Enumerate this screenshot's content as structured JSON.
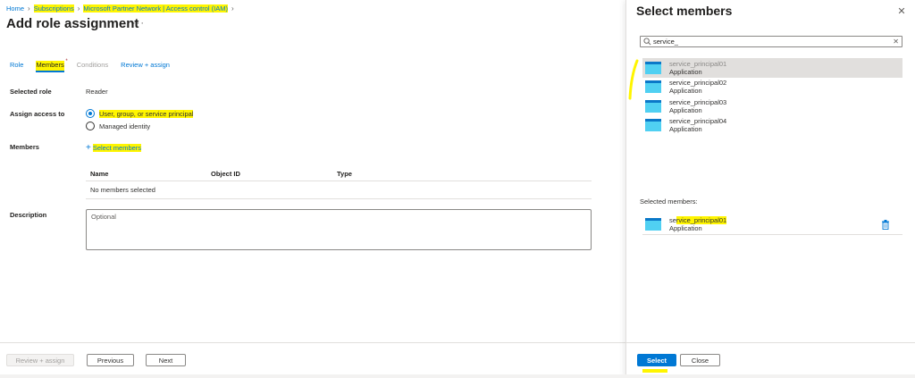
{
  "breadcrumb": {
    "home": "Home",
    "subscriptions": "Subscriptions",
    "resource": "Microsoft Partner Network | Access control (IAM)"
  },
  "page": {
    "title": "Add role assignment",
    "more": "···"
  },
  "tabs": [
    {
      "label": "Role",
      "state": "link"
    },
    {
      "label": "Members",
      "state": "active",
      "required_mark": "*"
    },
    {
      "label": "Conditions",
      "state": "disabled"
    },
    {
      "label": "Review + assign",
      "state": "link"
    }
  ],
  "form": {
    "selected_role_label": "Selected role",
    "selected_role_value": "Reader",
    "assign_access_label": "Assign access to",
    "assign_options": [
      "User, group, or service principal",
      "Managed identity"
    ],
    "members_label": "Members",
    "select_members_link": "Select members",
    "table": {
      "columns": [
        "Name",
        "Object ID",
        "Type"
      ],
      "empty_text": "No members selected"
    },
    "description_label": "Description",
    "description_placeholder": "Optional"
  },
  "footer": {
    "review_assign": "Review + assign",
    "previous": "Previous",
    "next": "Next"
  },
  "panel": {
    "title": "Select members",
    "search_value": "service_",
    "results": [
      {
        "name": "service_principal01",
        "type": "Application",
        "selected": true
      },
      {
        "name": "service_principal02",
        "type": "Application",
        "selected": false
      },
      {
        "name": "service_principal03",
        "type": "Application",
        "selected": false
      },
      {
        "name": "service_principal04",
        "type": "Application",
        "selected": false
      }
    ],
    "selected_label": "Selected members:",
    "selected_members": [
      {
        "name": "service_principal01",
        "type": "Application"
      }
    ],
    "select_button": "Select",
    "close_button": "Close"
  },
  "colors": {
    "accent": "#0078d4",
    "highlight": "#fff500",
    "app_icon_top": "#0a78c8",
    "app_icon_body": "#50d0f2"
  }
}
